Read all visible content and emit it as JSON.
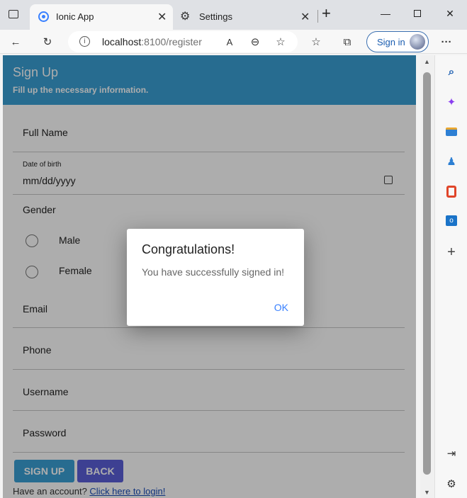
{
  "browser": {
    "tabs": [
      {
        "title": "Ionic App"
      },
      {
        "title": "Settings"
      }
    ],
    "new_tab_glyph": "+",
    "address": {
      "host": "localhost",
      "path": ":8100/register"
    },
    "sign_in_label": "Sign in"
  },
  "page": {
    "header": {
      "title": "Sign Up",
      "subtitle": "Fill up the necessary information."
    },
    "fields": {
      "full_name": "Full Name",
      "dob_label": "Date of birth",
      "dob_placeholder": "mm/dd/yyyy",
      "gender": "Gender",
      "male": "Male",
      "female": "Female",
      "email": "Email",
      "phone": "Phone",
      "username": "Username",
      "password": "Password"
    },
    "buttons": {
      "sign_up": "SIGN UP",
      "back": "BACK"
    },
    "footer": {
      "text": "Have an account? ",
      "link": "Click here to login!"
    }
  },
  "dialog": {
    "title": "Congratulations!",
    "message": "You have successfully signed in!",
    "ok": "OK"
  },
  "colors": {
    "header": "#3a9fd5",
    "sign_up_button": "#3a9fd5",
    "back_button": "#5a5fd8",
    "dialog_ok": "#3880ff"
  }
}
